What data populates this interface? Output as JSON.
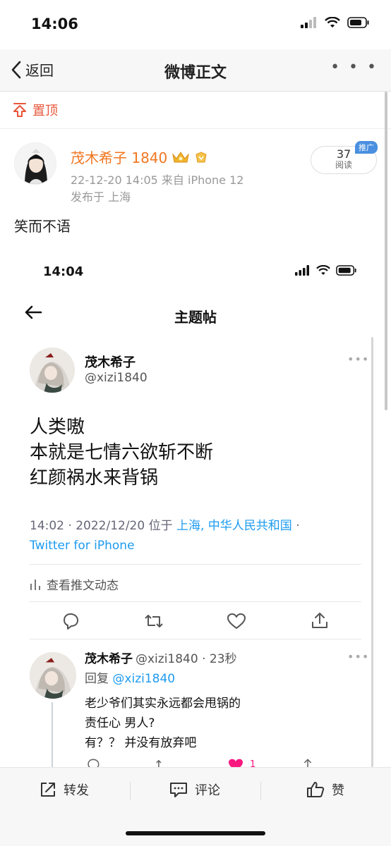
{
  "status_bar": {
    "time": "14:06"
  },
  "nav": {
    "back_label": "返回",
    "title": "微博正文",
    "more_label": "• • •"
  },
  "pinned": {
    "label": "置顶"
  },
  "post": {
    "username": "茂木希子 1840",
    "date_device": "22-12-20 14:05  来自 iPhone 12",
    "location": "发布于 上海",
    "read_count": "37",
    "read_label": "阅读",
    "promo_badge": "推广",
    "text": "笑而不语"
  },
  "embedded": {
    "status_time": "14:04",
    "title": "主题帖",
    "tweet": {
      "name": "茂木希子",
      "handle": "@xizi1840",
      "more": "•••",
      "lines": [
        "人类嗷",
        "本就是七情六欲斩不断",
        "红颜祸水来背锅"
      ],
      "meta_time": "14:02 · 2022/12/20 位于 ",
      "meta_location": "上海, 中华人民共和国",
      "meta_dot": " ·",
      "meta_client": "Twitter for iPhone",
      "activity_label": "查看推文动态"
    },
    "reply": {
      "name": "茂木希子",
      "handle_time": "@xizi1840 · 23秒",
      "more": "•••",
      "reply_prefix": "回复 ",
      "reply_to": "@xizi1840",
      "lines": [
        "老少爷们其实永远都会甩锅的",
        "责任心 男人?",
        "有？？ 并没有放弃吧"
      ],
      "like_count": "1"
    }
  },
  "bottom_bar": {
    "repost_label": "转发",
    "comment_label": "评论",
    "like_label": "赞"
  },
  "colors": {
    "accent_orange": "#f2761f",
    "pin_red": "#e8553a",
    "twitter_blue": "#1d9bf0",
    "like_pink": "#f91880"
  }
}
